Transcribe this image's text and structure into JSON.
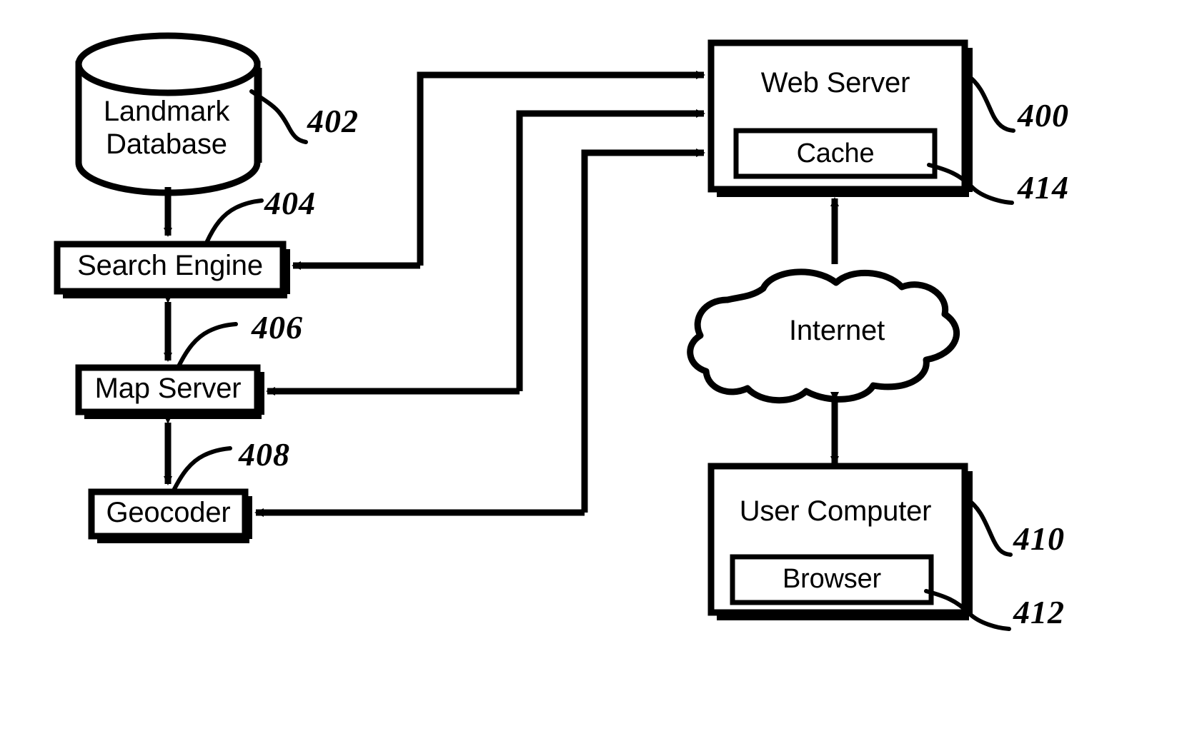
{
  "figure": {
    "type": "patent-block-diagram",
    "background_color": "#ffffff",
    "stroke_color": "#000000"
  },
  "nodes": {
    "landmark_database": {
      "label": "Landmark\nDatabase",
      "shape": "cylinder",
      "ref": "402"
    },
    "search_engine": {
      "label": "Search Engine",
      "shape": "rect",
      "ref": "404"
    },
    "map_server": {
      "label": "Map Server",
      "shape": "rect",
      "ref": "406"
    },
    "geocoder": {
      "label": "Geocoder",
      "shape": "rect",
      "ref": "408"
    },
    "web_server": {
      "label": "Web Server",
      "shape": "rect",
      "ref": "400"
    },
    "cache": {
      "label": "Cache",
      "shape": "rect",
      "ref": "414"
    },
    "internet": {
      "label": "Internet",
      "shape": "cloud",
      "ref": ""
    },
    "user_computer": {
      "label": "User Computer",
      "shape": "rect",
      "ref": "410"
    },
    "browser": {
      "label": "Browser",
      "shape": "rect",
      "ref": "412"
    }
  },
  "reference_numerals": {
    "n400": "400",
    "n402": "402",
    "n404": "404",
    "n406": "406",
    "n408": "408",
    "n410": "410",
    "n412": "412",
    "n414": "414"
  },
  "connections": [
    {
      "from": "landmark_database",
      "to": "search_engine",
      "style": "single-arrow",
      "direction": "down"
    },
    {
      "from": "search_engine",
      "to": "map_server",
      "style": "double-arrow",
      "direction": "vertical"
    },
    {
      "from": "map_server",
      "to": "geocoder",
      "style": "double-arrow",
      "direction": "vertical"
    },
    {
      "from": "search_engine",
      "to": "web_server",
      "style": "single-arrow",
      "direction": "to-web-server"
    },
    {
      "from": "map_server",
      "to": "web_server",
      "style": "single-arrow",
      "direction": "to-web-server"
    },
    {
      "from": "geocoder",
      "to": "web_server",
      "style": "single-arrow",
      "direction": "to-web-server"
    },
    {
      "from": "web_server",
      "to": "search_engine",
      "style": "single-arrow",
      "direction": "to-search-engine"
    },
    {
      "from": "web_server",
      "to": "map_server",
      "style": "single-arrow",
      "direction": "to-map-server"
    },
    {
      "from": "web_server",
      "to": "geocoder",
      "style": "single-arrow",
      "direction": "to-geocoder"
    },
    {
      "from": "web_server",
      "to": "internet",
      "style": "double-arrow",
      "direction": "vertical"
    },
    {
      "from": "internet",
      "to": "user_computer",
      "style": "double-arrow",
      "direction": "vertical"
    }
  ]
}
